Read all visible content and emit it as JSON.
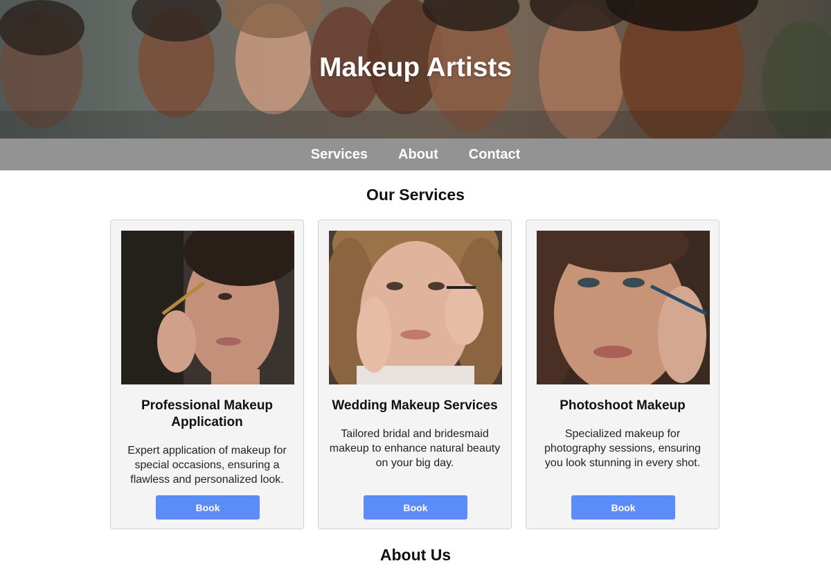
{
  "header": {
    "title": "Makeup Artists"
  },
  "nav": {
    "items": [
      {
        "label": "Services"
      },
      {
        "label": "About"
      },
      {
        "label": "Contact"
      }
    ]
  },
  "services": {
    "heading": "Our Services",
    "cards": [
      {
        "title": "Professional Makeup Application",
        "description": "Expert application of makeup for special occasions, ensuring a flawless and personalized look.",
        "button": "Book"
      },
      {
        "title": "Wedding Makeup Services",
        "description": "Tailored bridal and bridesmaid makeup to enhance natural beauty on your big day.",
        "button": "Book"
      },
      {
        "title": "Photoshoot Makeup",
        "description": "Specialized makeup for photography sessions, ensuring you look stunning in every shot.",
        "button": "Book"
      }
    ]
  },
  "about": {
    "heading": "About Us"
  },
  "colors": {
    "nav_background": "#939393",
    "button": "#5b8cf8",
    "card_background": "#f4f4f4"
  }
}
